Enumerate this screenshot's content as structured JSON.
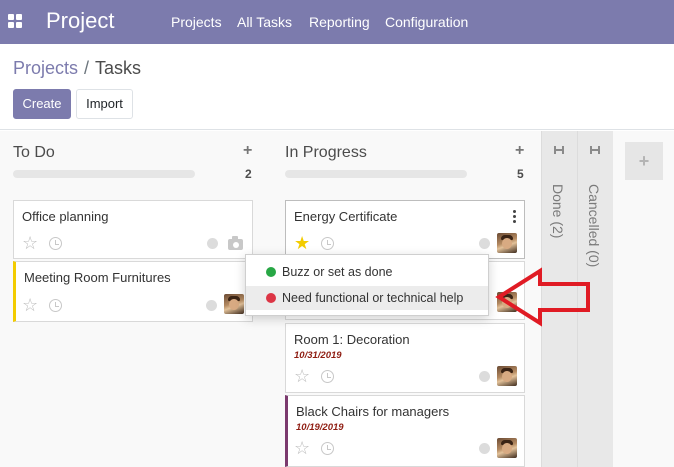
{
  "navbar": {
    "app_title": "Project",
    "menu": [
      "Projects",
      "All Tasks",
      "Reporting",
      "Configuration"
    ],
    "color": "#7c7bad"
  },
  "breadcrumb": {
    "parent": "Projects",
    "separator": "/",
    "current": "Tasks"
  },
  "buttons": {
    "create": "Create",
    "import": "Import"
  },
  "columns": {
    "todo": {
      "title": "To Do",
      "count": "2",
      "cards": [
        {
          "title": "Office planning",
          "starred": false,
          "icons": [
            "star-icon",
            "clock-icon",
            "state-dot",
            "camera-icon"
          ]
        },
        {
          "title": "Meeting Room Furnitures",
          "starred": false,
          "accent": "#f3cc00",
          "icons": [
            "star-icon",
            "clock-icon",
            "state-dot",
            "avatar"
          ]
        }
      ]
    },
    "inprogress": {
      "title": "In Progress",
      "count": "5",
      "cards": [
        {
          "title": "Energy Certificate",
          "starred": true,
          "icons": [
            "star-icon",
            "clock-icon",
            "state-dot",
            "avatar",
            "kebab-icon"
          ]
        },
        {
          "title": "Room 1: Decoration",
          "date": "10/31/2019",
          "starred": false
        },
        {
          "title": "Black Chairs for managers",
          "date": "10/19/2019",
          "starred": false,
          "accent": "#7b3a6e"
        }
      ]
    },
    "folded": [
      {
        "label": "Done (2)"
      },
      {
        "label": "Cancelled (0)"
      }
    ]
  },
  "kanban_state_menu": {
    "items": [
      {
        "label": "Buzz or set as done",
        "color": "#28a745"
      },
      {
        "label": "Need functional or technical help",
        "color": "#dc3545"
      }
    ]
  },
  "annotation_arrow_color": "#e01b24",
  "add_column_glyph": "+",
  "column_add_glyph": "+"
}
